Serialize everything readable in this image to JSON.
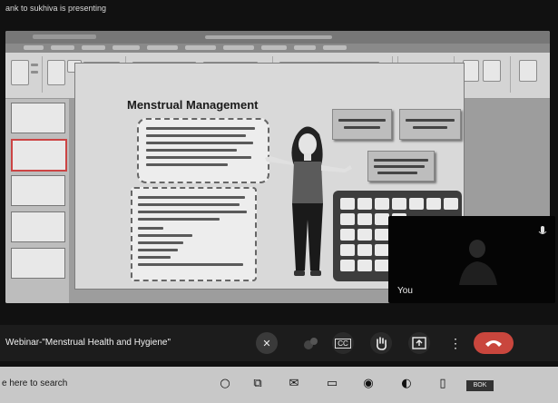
{
  "presenting_banner": "ank to sukhiva is presenting",
  "slide": {
    "title": "Menstrual Management"
  },
  "self_video": {
    "label": "You"
  },
  "meeting": {
    "title": "Webinar-\"Menstrual Health and Hygiene\"",
    "controls": [
      {
        "name": "mic-icon",
        "glyph": "✕"
      },
      {
        "name": "more-dots-icon",
        "glyph": "⁝"
      },
      {
        "name": "captions-icon",
        "glyph": "CC"
      },
      {
        "name": "raise-hand-icon",
        "glyph": "✋"
      },
      {
        "name": "present-icon",
        "glyph": "⬆"
      },
      {
        "name": "options-icon",
        "glyph": "⋮"
      },
      {
        "name": "end-call-icon",
        "glyph": "☎"
      }
    ]
  },
  "taskbar": {
    "search_text": "e here to search",
    "tray_badge": "BOK"
  },
  "colors": {
    "end_call": "#c9463d",
    "hand_button": "#2a2a2a",
    "background": "#111111"
  }
}
